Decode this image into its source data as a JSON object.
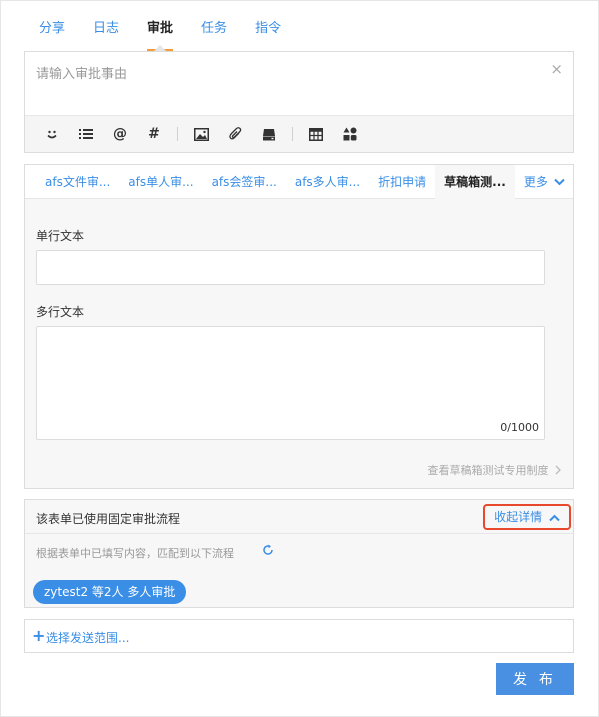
{
  "top_tabs": [
    "分享",
    "日志",
    "审批",
    "任务",
    "指令"
  ],
  "compose": {
    "placeholder": "请输入审批事由",
    "close_glyph": "×"
  },
  "toolbar_icons": [
    "emoji-icon",
    "list-icon",
    "mention-icon",
    "hashtag-icon",
    "image-icon",
    "attachment-icon",
    "drive-icon",
    "table-icon",
    "apps-icon"
  ],
  "template_tabs": [
    "afs文件审...",
    "afs单人审...",
    "afs会签审...",
    "afs多人审...",
    "折扣申请",
    "草稿箱测..."
  ],
  "template_more": "更多",
  "form": {
    "single_label": "单行文本",
    "multi_label": "多行文本",
    "counter": "0/1000",
    "policy_link": "查看草稿箱测试专用制度"
  },
  "flow": {
    "title": "该表单已使用固定审批流程",
    "collapse": "收起详情",
    "note": "根据表单中已填写内容，匹配到以下流程",
    "chip": "zytest2 等2人 多人审批"
  },
  "scope": {
    "label": "选择发送范围..."
  },
  "publish_label": "发 布"
}
